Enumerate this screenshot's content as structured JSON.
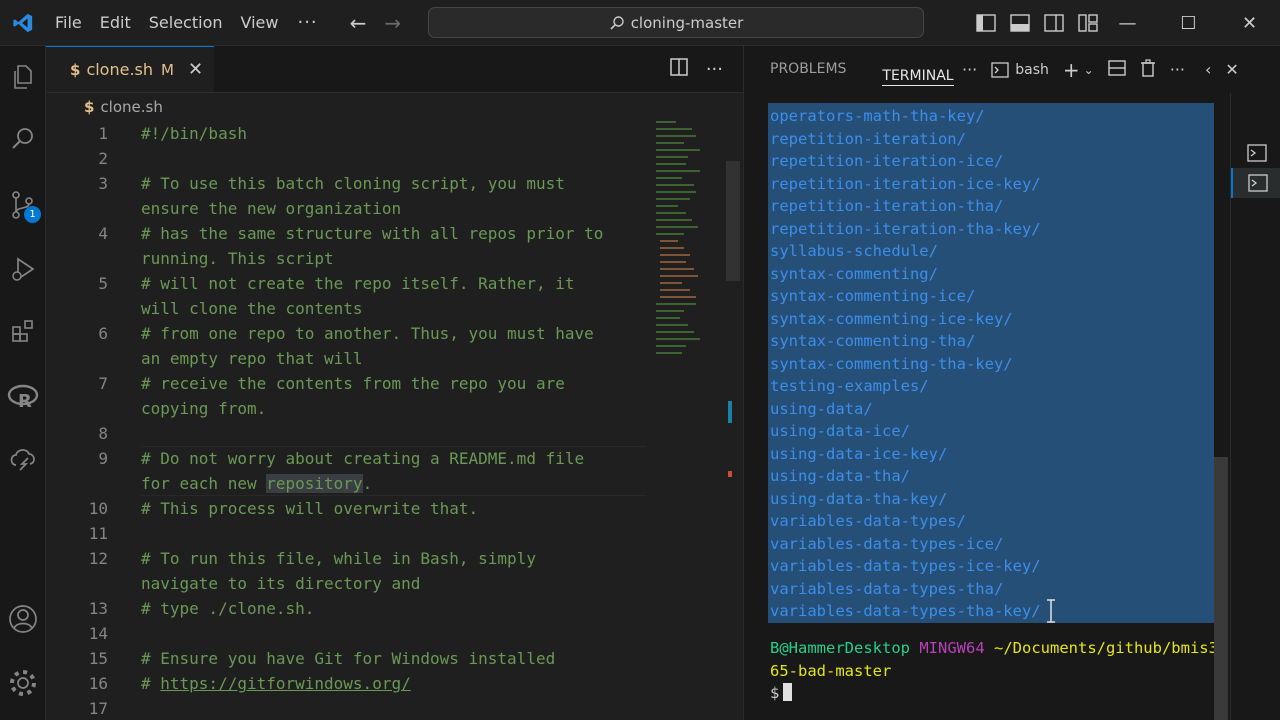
{
  "titlebar": {
    "menu": [
      "File",
      "Edit",
      "Selection",
      "View"
    ],
    "more": "···",
    "search_text": "cloning-master",
    "back_arrow": "←",
    "forward_arrow": "→"
  },
  "window_controls": {
    "minimize": "—",
    "maximize": "☐",
    "close": "✕"
  },
  "activity_bar": {
    "items": [
      "explorer-icon",
      "search-icon",
      "source-control-icon",
      "run-debug-icon",
      "extensions-icon",
      "r-icon",
      "remote-icon",
      "accounts-icon",
      "manage-icon"
    ],
    "source_control_badge": "1"
  },
  "editor": {
    "tab": {
      "icon": "$",
      "name": "clone.sh",
      "status": "M",
      "close": "✕"
    },
    "breadcrumb": {
      "icon": "$",
      "name": "clone.sh"
    },
    "lines": [
      {
        "n": "1",
        "text": "#!/bin/bash"
      },
      {
        "n": "2",
        "text": ""
      },
      {
        "n": "3",
        "text": "# To use this batch cloning script, you must"
      },
      {
        "n": "",
        "text": "ensure the new organization"
      },
      {
        "n": "4",
        "text": "# has the same structure with all repos prior to"
      },
      {
        "n": "",
        "text": "running. This script"
      },
      {
        "n": "5",
        "text": "# will not create the repo itself. Rather, it"
      },
      {
        "n": "",
        "text": "will clone the contents"
      },
      {
        "n": "6",
        "text": "# from one repo to another. Thus, you must have"
      },
      {
        "n": "",
        "text": "an empty repo that will"
      },
      {
        "n": "7",
        "text": "# receive the contents from the repo you are"
      },
      {
        "n": "",
        "text": "copying from."
      },
      {
        "n": "8",
        "text": ""
      },
      {
        "n": "9",
        "text": "# Do not worry about creating a README.md file"
      },
      {
        "n": "",
        "pre": "for each new ",
        "hl": "repository",
        "post": "."
      },
      {
        "n": "10",
        "text": "# This process will overwrite that."
      },
      {
        "n": "11",
        "text": ""
      },
      {
        "n": "12",
        "text": "# To run this file, while in Bash, simply"
      },
      {
        "n": "",
        "text": "navigate to its directory and"
      },
      {
        "n": "13",
        "text": "# type ./clone.sh."
      },
      {
        "n": "14",
        "text": ""
      },
      {
        "n": "15",
        "text": "# Ensure you have Git for Windows installed"
      },
      {
        "n": "16",
        "pre": "# ",
        "link": "https://gitforwindows.org/",
        "post": ""
      },
      {
        "n": "17",
        "text": ""
      }
    ]
  },
  "panel": {
    "tabs": [
      "PROBLEMS",
      "TERMINAL"
    ],
    "active_tab": "TERMINAL",
    "terminal_name": "bash",
    "terminal_lines": [
      "operators-math-tha-key/",
      "repetition-iteration/",
      "repetition-iteration-ice/",
      "repetition-iteration-ice-key/",
      "repetition-iteration-tha/",
      "repetition-iteration-tha-key/",
      "syllabus-schedule/",
      "syntax-commenting/",
      "syntax-commenting-ice/",
      "syntax-commenting-ice-key/",
      "syntax-commenting-tha/",
      "syntax-commenting-tha-key/",
      "testing-examples/",
      "using-data/",
      "using-data-ice/",
      "using-data-ice-key/",
      "using-data-tha/",
      "using-data-tha-key/",
      "variables-data-types/",
      "variables-data-types-ice/",
      "variables-data-types-ice-key/",
      "variables-data-types-tha/",
      "variables-data-types-tha-key/"
    ],
    "prompt": {
      "user": "B@HammerDesktop",
      "host": "MINGW64",
      "path1": "~/Documents/github/bmis3",
      "path2": "65-bad-master",
      "symbol": "$"
    }
  },
  "colors": {
    "accent": "#0078d4",
    "comment": "#6a9955",
    "dir": "#3b8eea",
    "selection": "#264f78"
  }
}
